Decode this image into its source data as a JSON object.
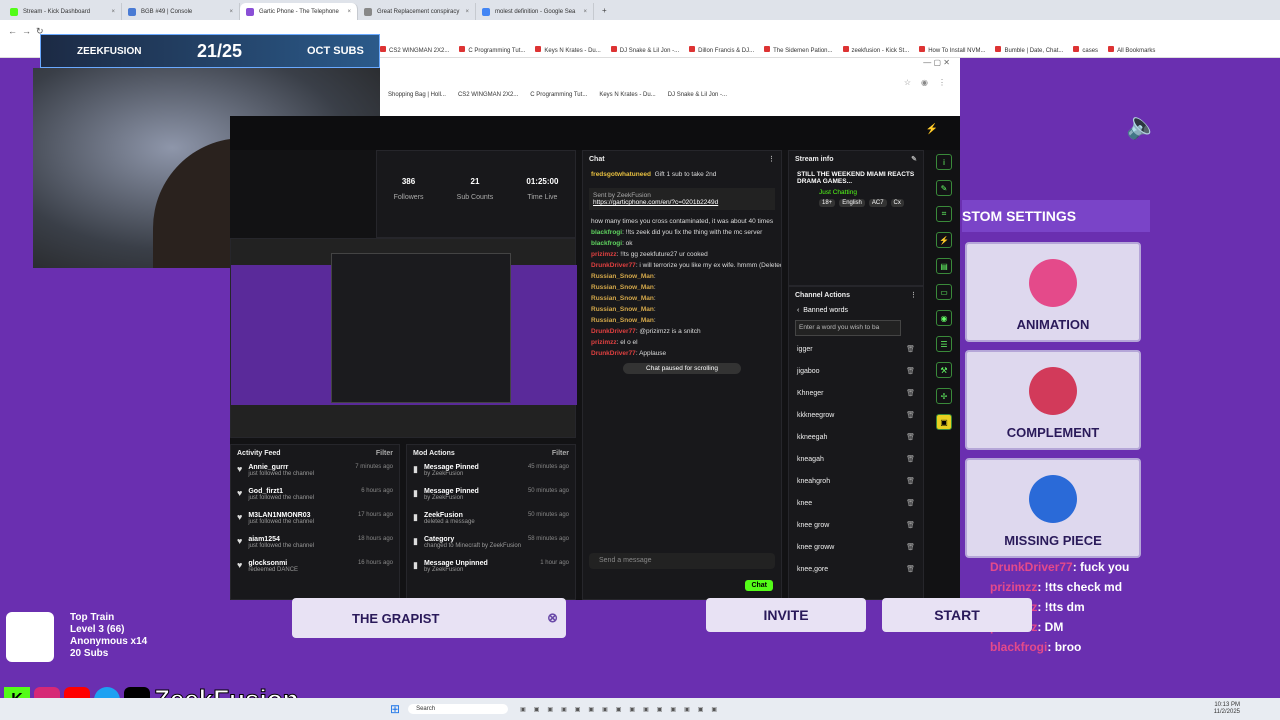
{
  "browser_tabs": [
    {
      "label": "Stream - Kick Dashboard",
      "color": "#53fc18"
    },
    {
      "label": "BGB #49 | Console",
      "color": "#4a7bd4"
    },
    {
      "label": "Gartic Phone - The Telephone",
      "color": "#8a4fd6"
    },
    {
      "label": "Great Replacement conspiracy",
      "color": "#888"
    },
    {
      "label": "molest definition - Google Sea",
      "color": "#4285f4"
    }
  ],
  "bookmarks": [
    "CS2 WINGMAN 2X2...",
    "C Programming Tut...",
    "Keys N Krates - Du...",
    "DJ Snake & Lil Jon -...",
    "Dillon Francis & DJ...",
    "The Sidemen Pation...",
    "zeekfusion - Kick St...",
    "How To Install NVM...",
    "Bumble | Date, Chat...",
    "cases",
    "All Bookmarks"
  ],
  "overlay": {
    "brand": "ZEEKFUSION",
    "count": "21/25",
    "label": "OCT SUBS"
  },
  "bookmarks2": [
    "Shopping Bag | Holl...",
    "CS2 WINGMAN 2X2...",
    "C Programming Tut...",
    "Keys N Krates - Du...",
    "DJ Snake & Lil Jon -..."
  ],
  "stats": [
    {
      "v": "386",
      "l": "Followers"
    },
    {
      "v": "21",
      "l": "Sub Counts"
    },
    {
      "v": "01:25:00",
      "l": "Time Live"
    }
  ],
  "activity": {
    "title": "Activity Feed",
    "filter": "Filter",
    "items": [
      {
        "n": "Annie_gurrr",
        "s": "just followed the channel",
        "t": "7 minutes ago"
      },
      {
        "n": "God_firzt1",
        "s": "just followed the channel",
        "t": "6 hours ago"
      },
      {
        "n": "M3LAN1NMONR03",
        "s": "just followed the channel",
        "t": "17 hours ago"
      },
      {
        "n": "aiam1254",
        "s": "just followed the channel",
        "t": "18 hours ago"
      },
      {
        "n": "glocksonmi",
        "s": "redeemed DANCE",
        "t": "16 hours ago"
      }
    ]
  },
  "modactions": {
    "title": "Mod Actions",
    "filter": "Filter",
    "items": [
      {
        "n": "Message Pinned",
        "s": "by ZeekFusion",
        "t": "45 minutes ago"
      },
      {
        "n": "Message Pinned",
        "s": "by ZeekFusion",
        "t": "50 minutes ago"
      },
      {
        "n": "ZeekFusion",
        "s": "deleted a message",
        "t": "50 minutes ago"
      },
      {
        "n": "Category",
        "s": "changed to Minecraft by ZeekFusion",
        "t": "58 minutes ago"
      },
      {
        "n": "Message Unpinned",
        "s": "by ZeekFusion",
        "t": "1 hour ago"
      }
    ]
  },
  "chat": {
    "title": "Chat",
    "gifter": "fredsgotwhatuneed",
    "gift": "Gift 1 sub to take 2nd",
    "sent_by": "Sent by ZeekFusion",
    "pinned_link": "https://garticphone.com/en/?c=0201b2249d",
    "lines": [
      {
        "u": "",
        "c": "#ddd",
        "m": "how many times you cross contaminated, it was about 40 times"
      },
      {
        "u": "blackfrogi",
        "c": "#5fd35f",
        "m": ": !!ts zeek did you fix the thing with the mc server"
      },
      {
        "u": "blackfrogi",
        "c": "#5fd35f",
        "m": ": ok"
      },
      {
        "u": "prizimzz",
        "c": "#e04040",
        "m": ": !!ts gg zeekfuture27 ur cooked"
      },
      {
        "u": "DrunkDriver77",
        "c": "#e04040",
        "m": ": i will terrorize you like my ex wife. hmmm (Deleted)"
      },
      {
        "u": "Russian_Snow_Man",
        "c": "#d4a84a",
        "m": ":"
      },
      {
        "u": "Russian_Snow_Man",
        "c": "#d4a84a",
        "m": ":"
      },
      {
        "u": "Russian_Snow_Man",
        "c": "#d4a84a",
        "m": ":"
      },
      {
        "u": "Russian_Snow_Man",
        "c": "#d4a84a",
        "m": ":"
      },
      {
        "u": "Russian_Snow_Man",
        "c": "#d4a84a",
        "m": ":"
      },
      {
        "u": "DrunkDriver77",
        "c": "#e04040",
        "m": ": @prizimzz is a snitch"
      },
      {
        "u": "prizimzz",
        "c": "#e04040",
        "m": ": el o el"
      },
      {
        "u": "DrunkDriver77",
        "c": "#e04040",
        "m": ": Applause"
      }
    ],
    "paused": "Chat paused for scrolling",
    "placeholder": "Send a message",
    "send": "Chat"
  },
  "streaminfo": {
    "title": "Stream info",
    "name": "STILL THE WEEKEND MIAMI REACTS DRAMA GAMES...",
    "category": "Just Chatting",
    "tags": [
      "18+",
      "English",
      "AC7",
      "Cx"
    ]
  },
  "channel": {
    "title": "Channel Actions",
    "sub": "Banned words",
    "placeholder": "Enter a word you wish to ba",
    "words": [
      "igger",
      "jigaboo",
      "Khneger",
      "kkkneegrow",
      "kkneegah",
      "kneagah",
      "kneahgroh",
      "knee",
      "knee grow",
      "knee groww",
      "knee,gore"
    ]
  },
  "game": {
    "heading": "STOM SETTINGS",
    "cards": [
      "ANIMATION",
      "COMPLEMENT",
      "MISSING PIECE"
    ],
    "player": "THE GRAPIST",
    "invite": "INVITE",
    "start": "START"
  },
  "overlay_chat": [
    {
      "u": "DrunkDriver77",
      "m": ": fuck you"
    },
    {
      "u": "prizimzz",
      "m": ": !tts check md"
    },
    {
      "u": "prizimzz",
      "m": ": !tts dm"
    },
    {
      "u": "prizimzz",
      "m": ": DM"
    },
    {
      "u": "blackfrogi",
      "m": ": broo"
    }
  ],
  "train": {
    "t1": "Top Train",
    "t2": "Level 3 (66)",
    "t3": "Anonymous x14",
    "t4": "20 Subs"
  },
  "handle": "ZeekFusion",
  "taskbar": {
    "search": "Search",
    "time": "10:13 PM",
    "date": "11/2/2025"
  }
}
